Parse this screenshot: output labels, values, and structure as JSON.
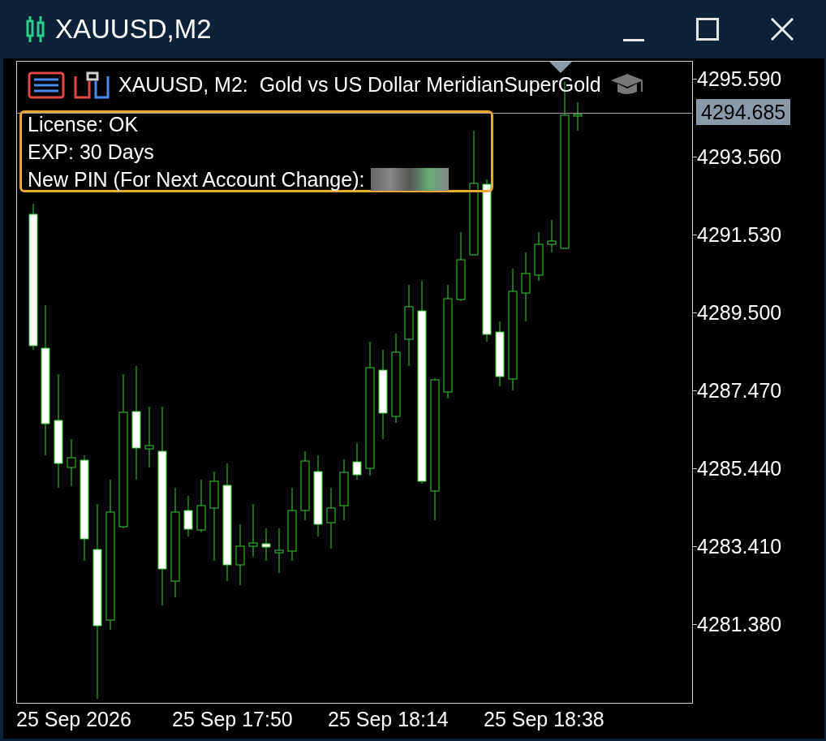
{
  "window": {
    "title": "XAUUSD,M2"
  },
  "chart": {
    "header": "XAUUSD, M2:  Gold vs US Dollar MeridianSuperGold",
    "info_panel": {
      "lines": [
        "License: OK",
        "EXP: 30 Days",
        "New PIN (For Next Account Change):"
      ]
    },
    "price_labels": [
      "4295.590",
      "4293.560",
      "4291.530",
      "4289.500",
      "4287.470",
      "4285.440",
      "4283.410",
      "4281.380"
    ],
    "current_price": "4294.685",
    "time_labels": [
      "25 Sep 2026",
      "25 Sep 17:50",
      "25 Sep 18:14",
      "25 Sep 18:38"
    ]
  }
}
